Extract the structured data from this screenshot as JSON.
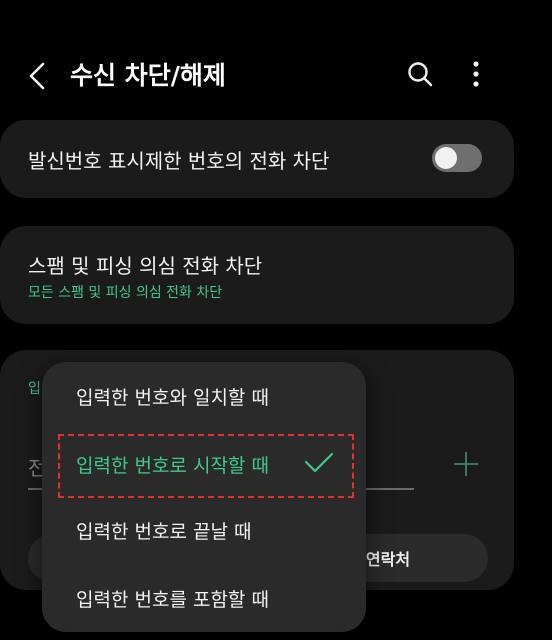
{
  "header": {
    "title": "수신 차단/해제"
  },
  "settings": {
    "hidden_caller_block": {
      "label": "발신번호 표시제한 번호의 전화 차단",
      "enabled": false
    },
    "spam_block": {
      "label": "스팸 및 피싱 의심 전화 차단",
      "sub": "모든 스팸 및 피싱 의심 전화 차단"
    },
    "number_entry": {
      "label_partial": "입",
      "input_partial": "전",
      "contacts_button": "연락처"
    }
  },
  "dropdown": {
    "options": [
      "입력한 번호와 일치할 때",
      "입력한 번호로 시작할 때",
      "입력한 번호로 끝날 때",
      "입력한 번호를 포함할 때"
    ],
    "selected_index": 1
  },
  "colors": {
    "accent": "#3ec98d",
    "highlight_border": "#e23131"
  }
}
